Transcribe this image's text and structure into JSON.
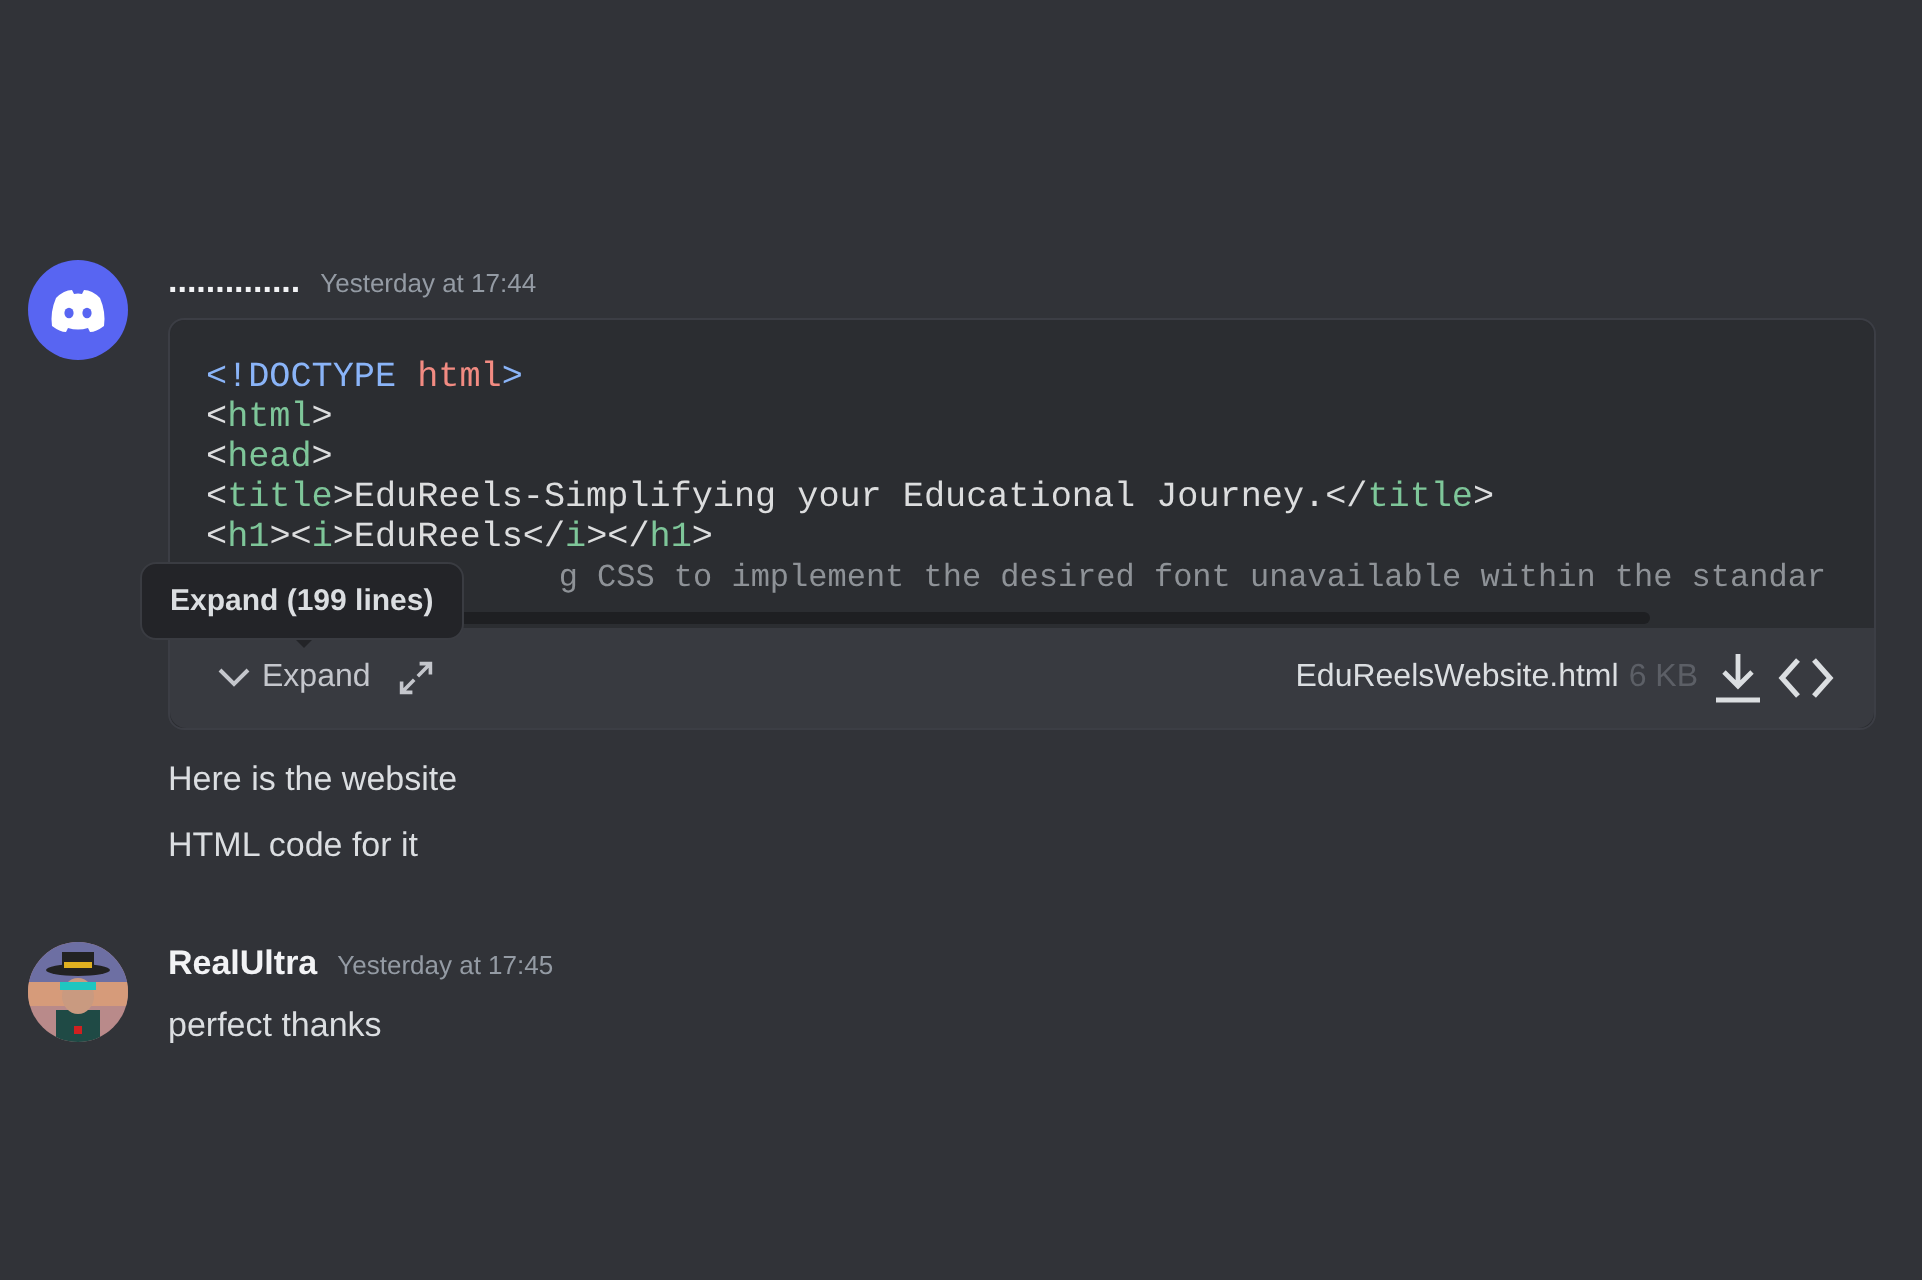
{
  "messages": [
    {
      "author": "..............",
      "time": "Yesterday at 17:44",
      "avatar": {
        "kind": "logo"
      },
      "attachment": {
        "code_lines": [
          {
            "hidden_prefix": false,
            "tokens": [
              {
                "kind": "punct",
                "text": "<!DOCTYPE "
              },
              {
                "kind": "attr",
                "text": "html"
              },
              {
                "kind": "punct",
                "text": ">"
              }
            ]
          },
          {
            "hidden_prefix": false,
            "tokens": [
              {
                "kind": "text",
                "text": "<"
              },
              {
                "kind": "tag",
                "text": "html"
              },
              {
                "kind": "text",
                "text": ">"
              }
            ]
          },
          {
            "hidden_prefix": false,
            "tokens": [
              {
                "kind": "text",
                "text": "<"
              },
              {
                "kind": "tag",
                "text": "head"
              },
              {
                "kind": "text",
                "text": ">"
              }
            ]
          },
          {
            "hidden_prefix": false,
            "tokens": [
              {
                "kind": "text",
                "text": "<"
              },
              {
                "kind": "tag",
                "text": "title"
              },
              {
                "kind": "text",
                "text": ">EduReels-Simplifying your Educational Journey.</"
              },
              {
                "kind": "tag",
                "text": "title"
              },
              {
                "kind": "text",
                "text": ">"
              }
            ]
          },
          {
            "hidden_prefix": false,
            "tokens": [
              {
                "kind": "text",
                "text": "<"
              },
              {
                "kind": "tag",
                "text": "h1"
              },
              {
                "kind": "text",
                "text": "><"
              },
              {
                "kind": "tag",
                "text": "i"
              },
              {
                "kind": "text",
                "text": ">EduReels</"
              },
              {
                "kind": "tag",
                "text": "i"
              },
              {
                "kind": "text",
                "text": "></"
              },
              {
                "kind": "tag",
                "text": "h1"
              },
              {
                "kind": "text",
                "text": ">"
              }
            ]
          },
          {
            "hidden_prefix": true,
            "tokens": [
              {
                "kind": "comment",
                "text": "g CSS to implement the desired font unavailable within the standar"
              }
            ]
          }
        ],
        "expand_label": "Expand",
        "tooltip": "Expand (199 lines)",
        "file_name": "EduReelsWebsite.html",
        "file_size": "6 KB"
      },
      "lines": [
        "Here is the website",
        "HTML code for it"
      ]
    },
    {
      "author": "RealUltra",
      "time": "Yesterday at 17:45",
      "avatar": {
        "kind": "picture"
      },
      "lines": [
        "perfect thanks"
      ]
    }
  ]
}
